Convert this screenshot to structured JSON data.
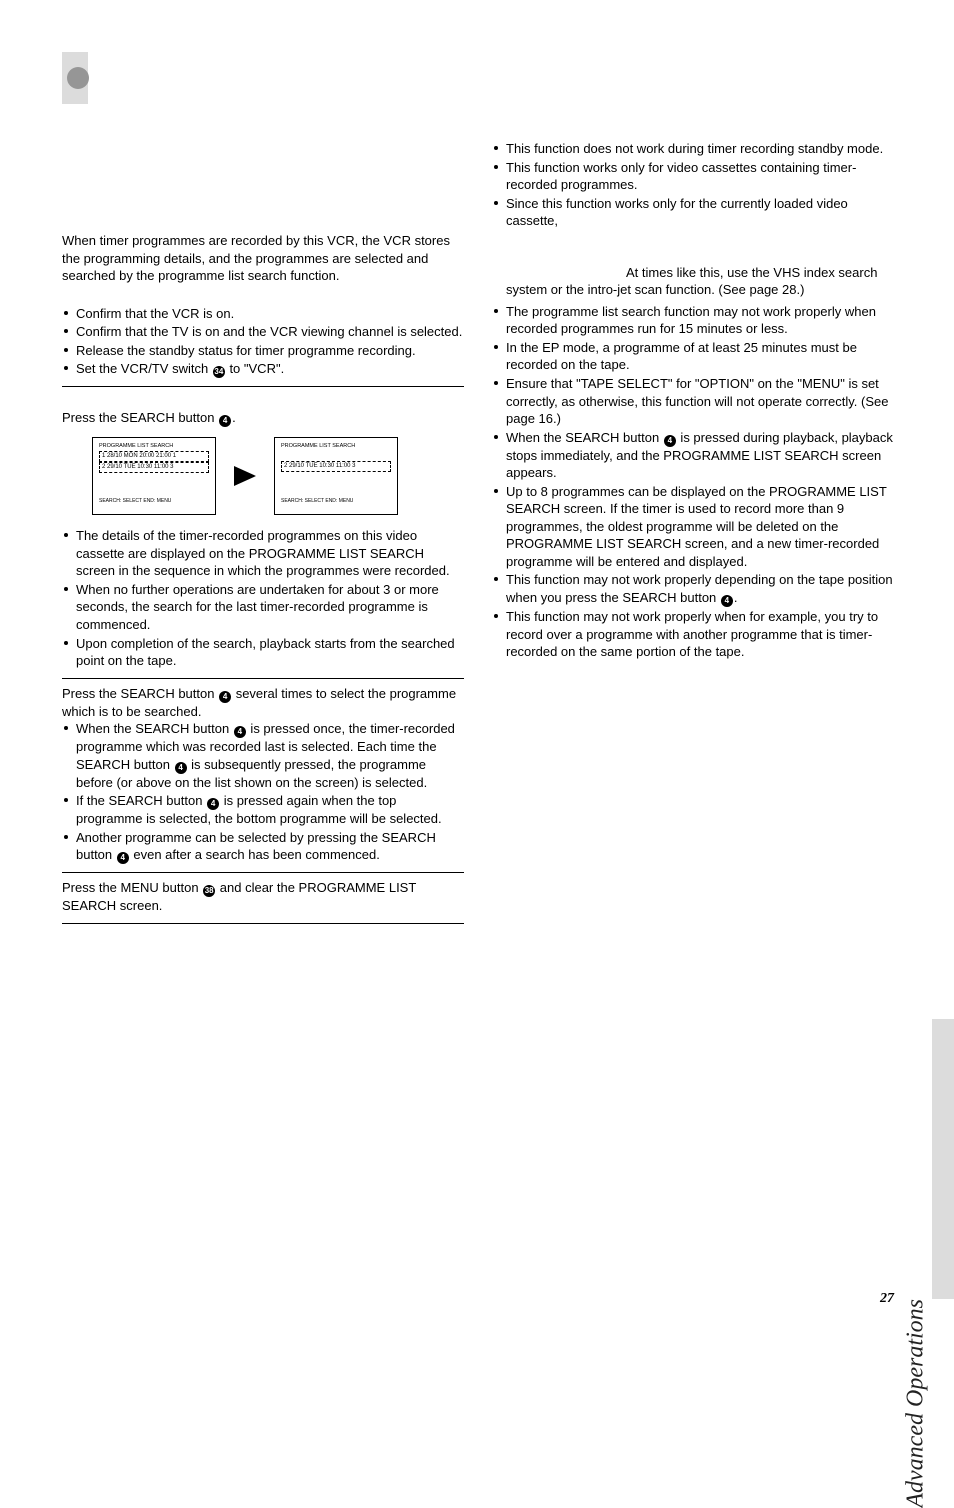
{
  "page_number": "27",
  "side_tab": "Advanced Operations",
  "circled": {
    "c4": "4",
    "c34": "34",
    "c38": "38"
  },
  "left": {
    "intro": "When timer programmes are recorded by this VCR, the VCR stores the programming details, and the programmes are selected and searched by the programme list search function.",
    "prep": [
      "Confirm that the VCR is on.",
      "Confirm that the TV is on and the VCR viewing channel is selected.",
      "Release the standby status for timer programme recording."
    ],
    "prep_set_pre": "Set the VCR/TV switch ",
    "prep_set_post": " to \"VCR\".",
    "step1_pre": "Press the SEARCH button ",
    "step1_post": ".",
    "step1_bullets": [
      "The details of the timer-recorded programmes on this video cassette are displayed on the PROGRAMME LIST SEARCH screen in the sequence in which the programmes were recorded.",
      "When no further operations are undertaken for about 3 or more seconds, the search for the last timer-recorded programme is commenced.",
      "Upon completion of the search, playback starts from the searched point on the tape."
    ],
    "step2_intro_pre": "Press the SEARCH button ",
    "step2_intro_post": " several times to select the programme which is to be searched.",
    "step2_b1_pre": "When the SEARCH button ",
    "step2_b1_mid": " is pressed once, the timer-recorded programme which was recorded last is selected. Each time the SEARCH button ",
    "step2_b1_post": " is subsequently pressed, the programme before (or above on the list shown on the screen) is selected.",
    "step2_b2_pre": "If the SEARCH button ",
    "step2_b2_post": " is pressed again when the top programme is selected, the bottom programme will be selected.",
    "step2_b3_pre": "Another programme can be selected by pressing the SEARCH button ",
    "step2_b3_post": " even after a search has been commenced.",
    "step3_pre": "Press the MENU button ",
    "step3_post": " and clear the PROGRAMME LIST SEARCH screen."
  },
  "right": {
    "b1": "This function does not work during timer recording standby mode.",
    "b2": "This function works only for video cassettes containing timer-recorded programmes.",
    "b3": "Since this function works only for the currently loaded video cassette,",
    "b3_cont": "At times like this, use the VHS index search system or the intro-jet scan function. (See page 28.)",
    "b4": "The programme list search function may not work properly when recorded programmes run for 15 minutes or less.",
    "b5": "In the EP mode, a programme of at least 25 minutes must be recorded on the tape.",
    "b6": "Ensure that \"TAPE SELECT\" for \"OPTION\" on the \"MENU\" is set correctly, as otherwise, this function will not operate correctly. (See page 16.)",
    "b7_pre": "When the SEARCH button ",
    "b7_post": " is pressed during playback, playback stops immediately, and the PROGRAMME LIST SEARCH screen appears.",
    "b8": "Up to 8 programmes can be displayed on the PROGRAMME LIST SEARCH screen. If the timer is used to record more than 9 programmes, the oldest programme will be deleted on the PROGRAMME LIST SEARCH screen, and a new timer-recorded programme will be entered and displayed.",
    "b9_pre": "This function may not work properly depending on the tape position when you press the SEARCH button ",
    "b9_post": ".",
    "b10": "This function may not work properly when for example, you try to record over a programme with another programme that is timer-recorded on the same portion of the tape."
  },
  "diagram": {
    "box1_title": "PROGRAMME LIST SEARCH",
    "box1_row1": "1 28/10 MON 20:00 21:00 1",
    "box1_row2": "2 29/10 TUE 10:30 11:00 3",
    "box1_foot": "SEARCH: SELECT  END: MENU",
    "box2_title": "PROGRAMME LIST SEARCH",
    "box2_row": "2 29/10 TUE 10:30 11:00 3",
    "box2_foot": "SEARCH: SELECT  END: MENU"
  }
}
